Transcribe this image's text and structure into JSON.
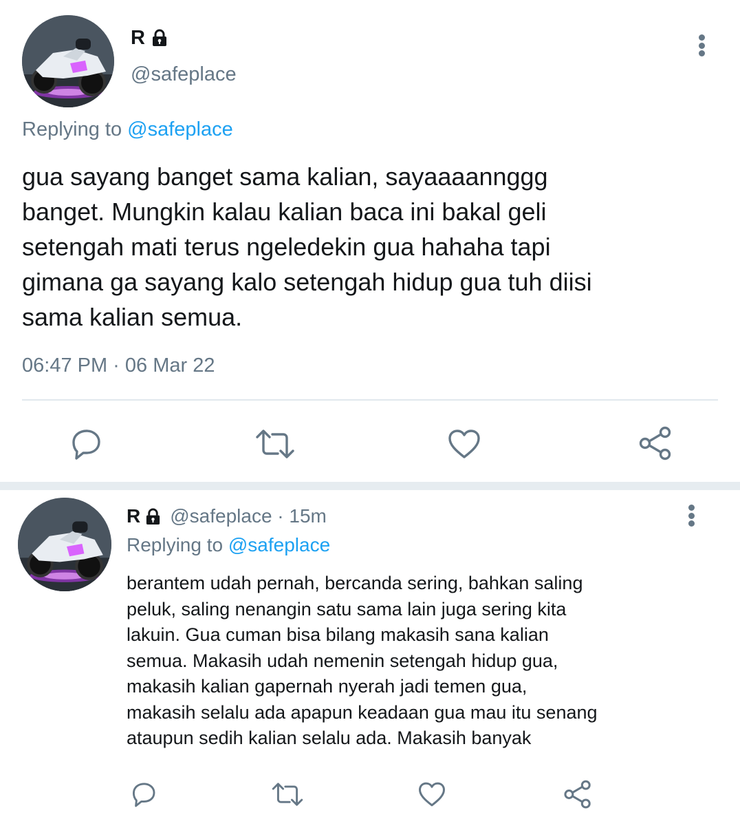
{
  "main_tweet": {
    "avatar_icon": "motorcycle-avatar",
    "name": "R",
    "lock_icon": "lock-icon",
    "handle": "@safeplace",
    "replying_prefix": "Replying to",
    "replying_to": "@safeplace",
    "text": "gua sayang banget sama kalian, sayaaaannggg\nbanget. Mungkin kalau kalian baca ini bakal geli\nsetengah mati terus ngeledekin gua hahaha tapi\ngimana ga sayang kalo setengah hidup gua tuh diisi\nsama kalian semua.",
    "timestamp": "06:47 PM · 06 Mar 22",
    "actions": [
      "reply-icon",
      "retweet-icon",
      "like-icon",
      "share-icon"
    ],
    "more_icon": "more-vertical-icon"
  },
  "reply_tweet": {
    "avatar_icon": "motorcycle-avatar",
    "name": "R",
    "lock_icon": "lock-icon",
    "handle_time": "@safeplace · 15m",
    "replying_prefix": "Replying to",
    "replying_to": "@safeplace",
    "text": "berantem udah pernah, bercanda sering, bahkan saling\npeluk, saling nenangin satu sama lain juga sering kita\nlakuin. Gua cuman bisa bilang makasih sana kalian\nsemua. Makasih udah nemenin setengah hidup gua,\nmakasih kalian gapernah nyerah jadi temen gua,\nmakasih selalu ada apapun keadaan gua mau itu senang\nataupun sedih kalian selalu ada. Makasih banyak",
    "actions": [
      "reply-icon",
      "retweet-icon",
      "like-icon",
      "share-icon"
    ],
    "more_icon": "more-vertical-icon"
  },
  "colors": {
    "text_primary": "#14171a",
    "text_secondary": "#657786",
    "link": "#1da1f2",
    "divider": "#e1e8ed",
    "thread_separator": "#e6ecf0",
    "avatar_glow": "#c73bff"
  }
}
